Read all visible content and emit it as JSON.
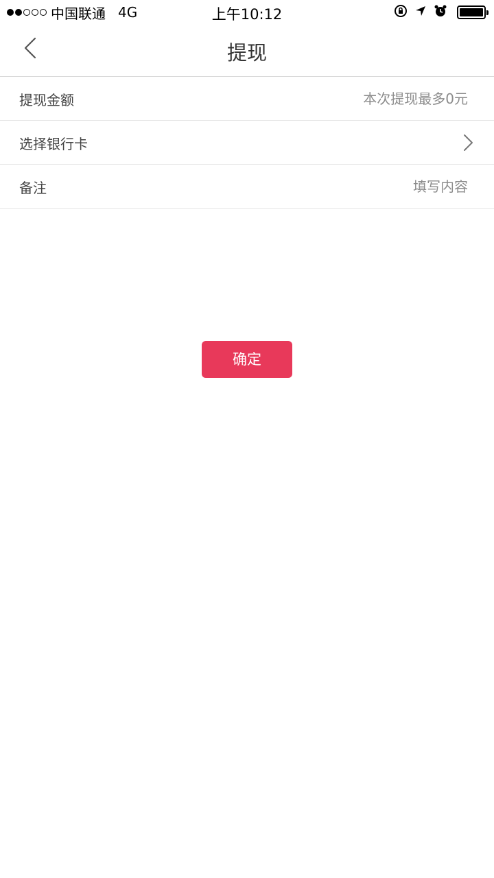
{
  "status_bar": {
    "carrier": "中国联通",
    "network": "4G",
    "time": "上午10:12",
    "signal_bars_filled": 2,
    "signal_bars_total": 5,
    "battery_level": 1.0
  },
  "nav": {
    "title": "提现",
    "back_icon": "chevron-left-icon"
  },
  "form": {
    "amount": {
      "label": "提现金额",
      "placeholder": "本次提现最多0元"
    },
    "bank_card": {
      "label": "选择银行卡",
      "icon": "chevron-right-icon"
    },
    "remark": {
      "label": "备注",
      "placeholder": "填写内容"
    }
  },
  "actions": {
    "confirm_label": "确定"
  },
  "colors": {
    "accent": "#e8395a",
    "divider": "#e5e5e5",
    "placeholder": "#8c8c8c"
  }
}
